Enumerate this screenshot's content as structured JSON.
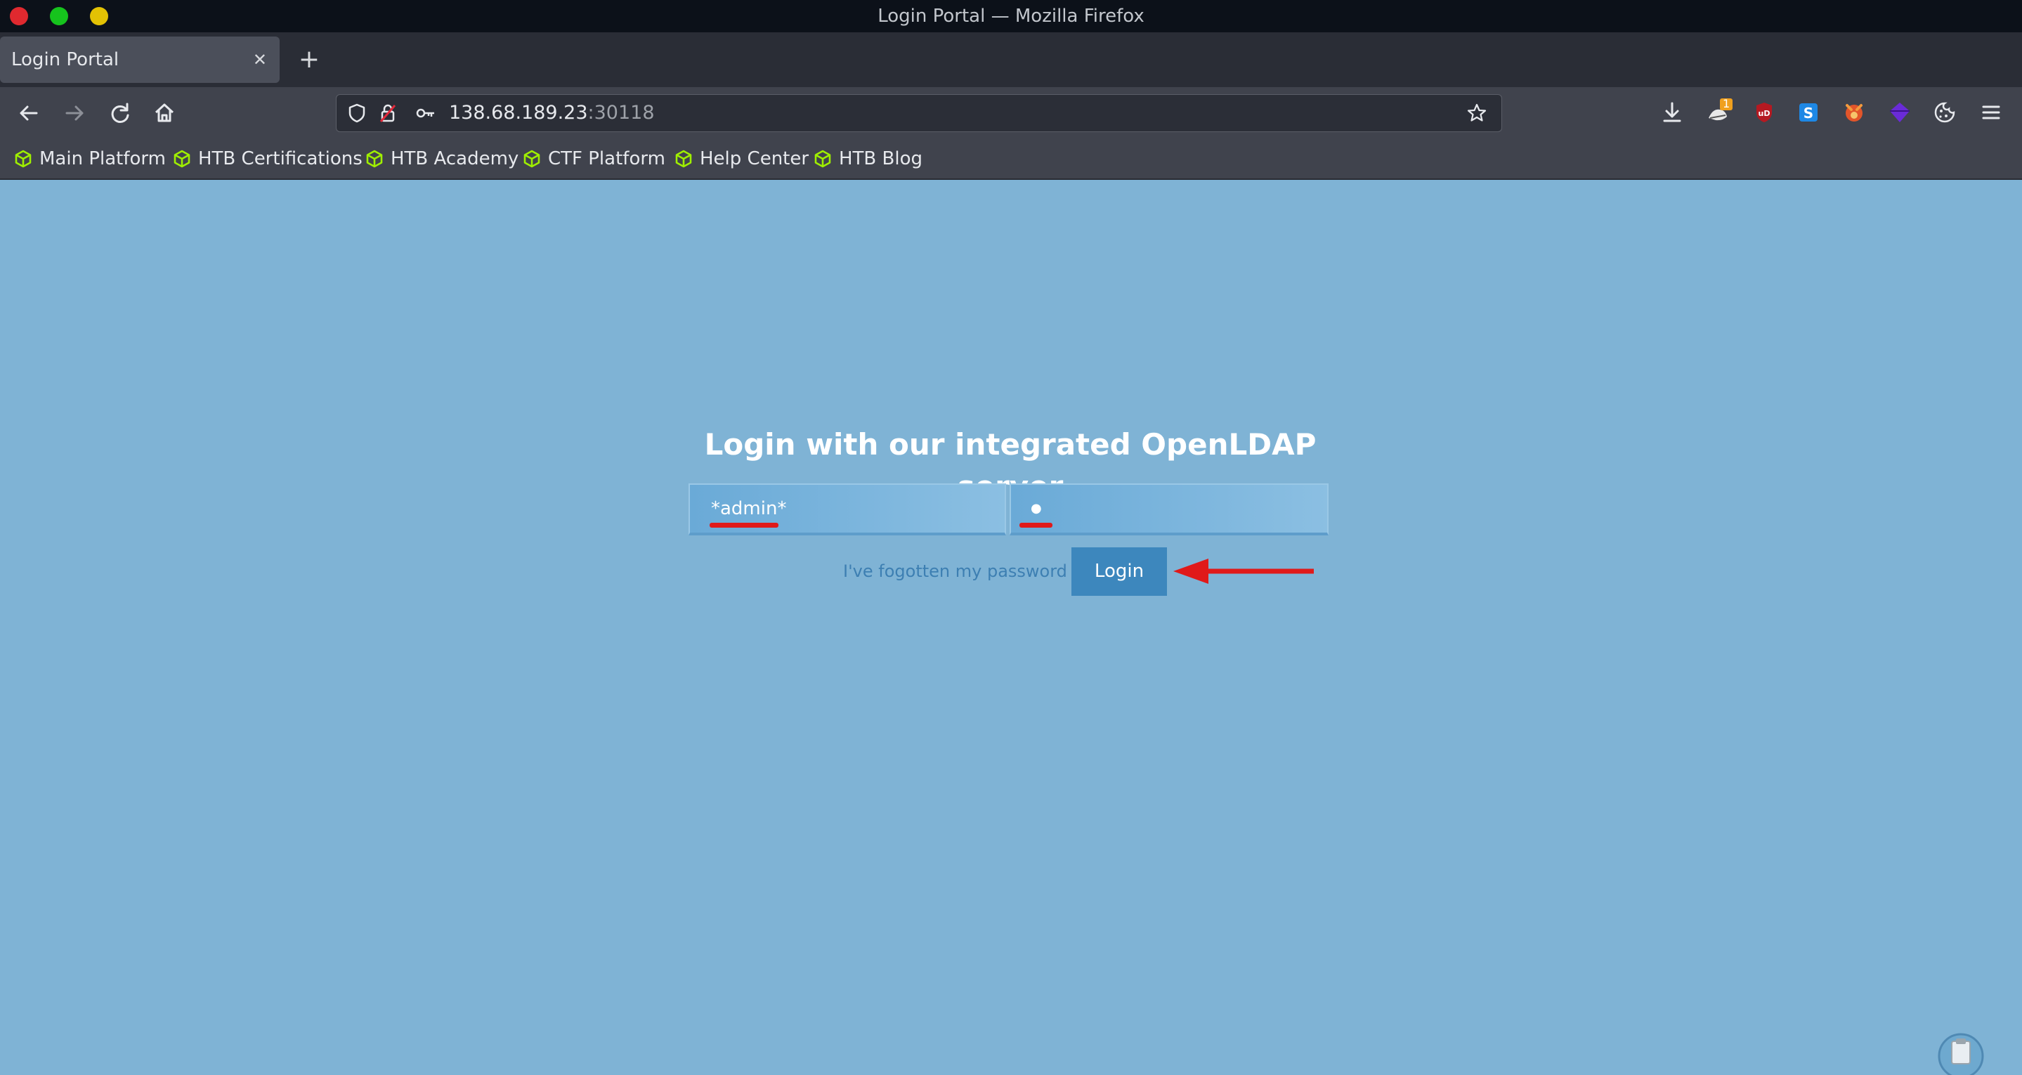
{
  "window": {
    "title": "Login Portal — Mozilla Firefox"
  },
  "tabs": [
    {
      "label": "Login Portal",
      "close_glyph": "✕",
      "active": true
    }
  ],
  "new_tab_glyph": "+",
  "navigation": {
    "url_host": "138.68.189.23",
    "url_port": ":30118",
    "buttons": [
      "back-icon",
      "forward-icon",
      "reload-icon",
      "home-icon"
    ],
    "toolbar_icons": [
      "download-icon",
      "extension-badge-icon",
      "ublock-icon",
      "s-extension-icon",
      "fox-extension-icon",
      "purple-extension-icon",
      "cookie-icon",
      "menu-icon"
    ],
    "extension_badge_count": "1"
  },
  "bookmarks": [
    {
      "label": "Main Platform"
    },
    {
      "label": "HTB Certifications"
    },
    {
      "label": "HTB Academy"
    },
    {
      "label": "CTF Platform"
    },
    {
      "label": "Help Center"
    },
    {
      "label": "HTB Blog"
    }
  ],
  "login": {
    "heading": "Login with our integrated OpenLDAP server",
    "username_value": "*admin*",
    "password_value": "●",
    "forgot_link": "I've fogotten my password",
    "submit_label": "Login"
  },
  "colors": {
    "page_background": "#7fb3d5",
    "login_button": "#3d87bd",
    "annotation_red": "#e01a1a",
    "bookmark_icon_green": "#9fef00"
  }
}
